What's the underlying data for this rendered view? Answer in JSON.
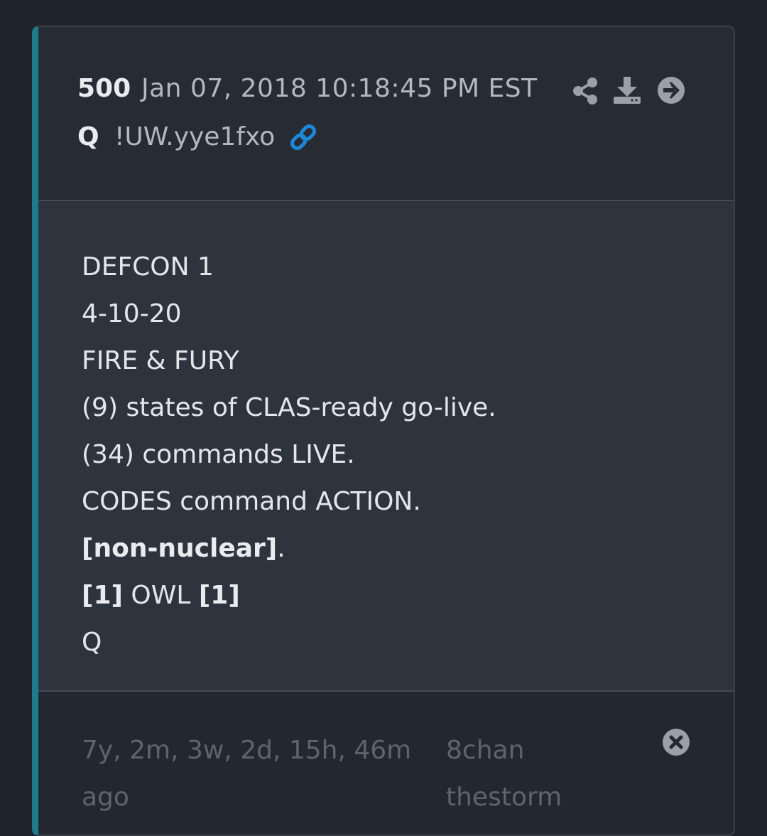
{
  "post": {
    "number": "500",
    "date": "Jan 07, 2018 10:18:45 PM EST",
    "author": "Q",
    "tripcode": "!UW.yye1fxo"
  },
  "icons": {
    "link": "link-icon",
    "share": "share-icon",
    "download": "download-icon",
    "open": "arrow-right-circle-icon",
    "close": "close-circle-icon"
  },
  "message": {
    "line1": "DEFCON 1",
    "line2": "4-10-20",
    "line3": "FIRE & FURY",
    "line4": "(9) states of CLAS-ready go-live.",
    "line5": "(34) commands LIVE.",
    "line6": "CODES command ACTION.",
    "line7_bold": "[non-nuclear]",
    "line7_rest": ".",
    "line8_bold1": "[1]",
    "line8_mid": " OWL ",
    "line8_bold2": "[1]",
    "line9": "Q"
  },
  "footer": {
    "ago": "7y, 2m, 3w, 2d, 15h, 46m ago",
    "source_board": "8chan",
    "source_name": "thestorm"
  },
  "colors": {
    "accent": "#1f7a8c",
    "link": "#1e88d6",
    "icon": "#9aa0a8"
  }
}
